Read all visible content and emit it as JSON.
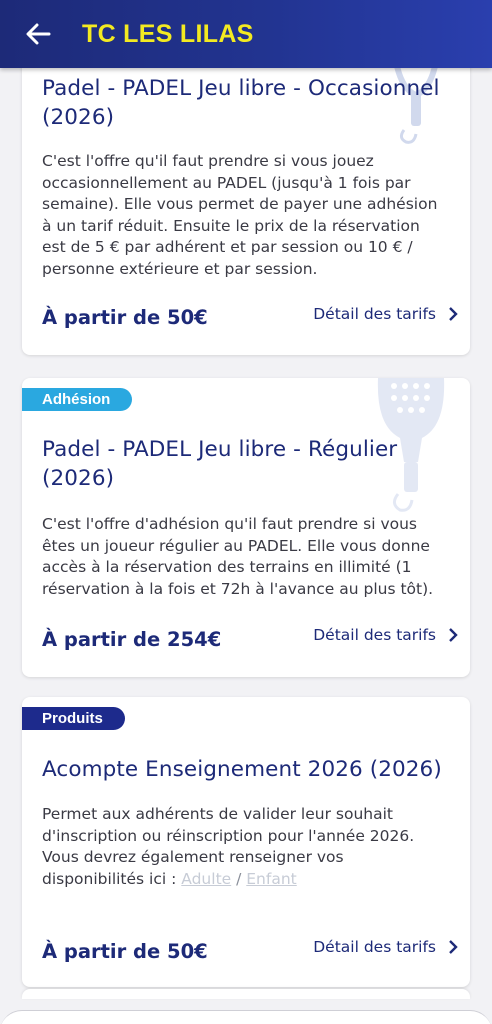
{
  "header": {
    "title": "TC LES LILAS",
    "back_icon": "arrow-left-icon",
    "title_color": "#f3ea21",
    "bar_color": "#223491"
  },
  "cards": [
    {
      "badge": "",
      "title": "Padel - PADEL Jeu libre - Occasionnel (2026)",
      "description": "C'est l'offre qu'il faut prendre si vous jouez occasionnellement au PADEL (jusqu'à 1 fois par semaine). Elle vous permet de payer une adhésion à un tarif réduit. Ensuite le prix de la réservation est de 5 € par adhérent et par session ou 10 € / personne extérieure et par session.",
      "price": "À partir de 50€",
      "detail_label": "Détail des tarifs",
      "icon": "padel-racket-icon"
    },
    {
      "badge": "Adhésion",
      "title": "Padel - PADEL Jeu libre - Régulier (2026)",
      "description": "C'est l'offre d'adhésion qu'il faut prendre si vous êtes un joueur régulier au PADEL. Elle vous donne accès à la réservation des terrains en illimité (1 réservation à la fois et 72h à l'avance au plus tôt).",
      "price": "À partir de 254€",
      "detail_label": "Détail des tarifs",
      "icon": "padel-racket-icon"
    },
    {
      "badge": "Produits",
      "title": "Acompte Enseignement 2026 (2026)",
      "description_prefix": "Permet aux adhérents de valider leur souhait d'inscription ou réinscription pour l'année 2026. Vous devrez également renseigner vos disponibilités ici : ",
      "link_adult": "Adulte",
      "link_separator": " / ",
      "link_child": "Enfant",
      "price": "À partir de 50€",
      "detail_label": "Détail des tarifs"
    }
  ],
  "colors": {
    "badge_membership": "#2aa8e0",
    "badge_products": "#1d2a8c",
    "accent_text": "#1d2a78"
  }
}
